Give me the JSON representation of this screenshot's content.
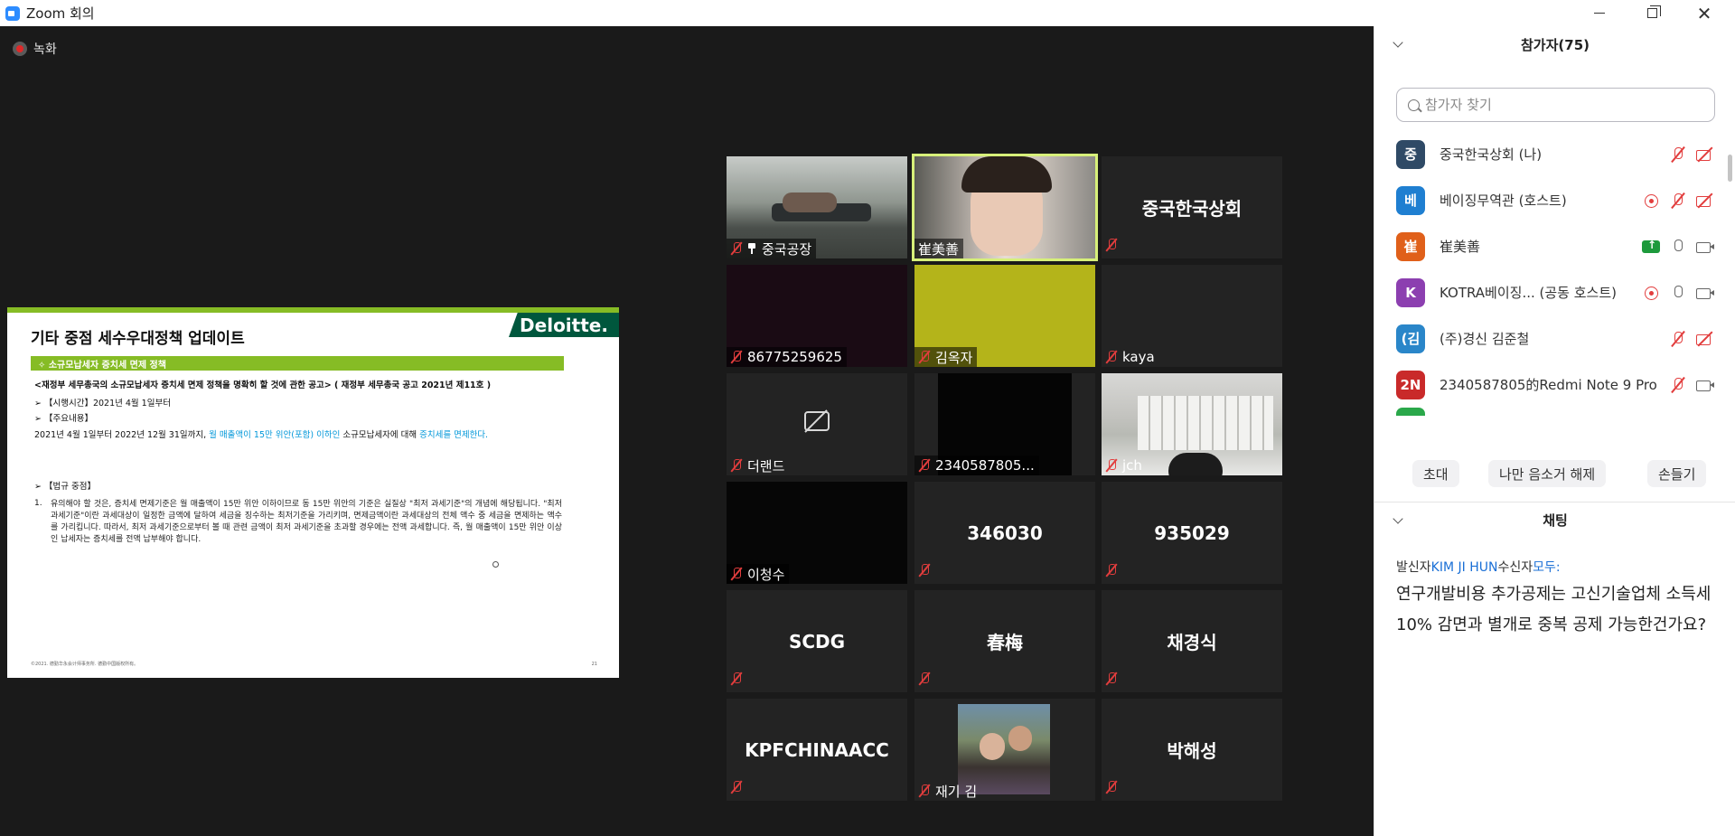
{
  "window": {
    "title": "Zoom 회의"
  },
  "recording": {
    "label": "녹화"
  },
  "slide": {
    "brand": "Deloitte.",
    "title": "기타 중점 세수우대정책 업데이트",
    "band": "✧  소규모납세자 증치세 면제 정책",
    "line1": "<재정부 세무총국의 소규모납세자 증치세 면제 정책을 명확히 할 것에 관한 공고> ( 재정부 세무총국 공고 2021년 제11호 )",
    "line2": "➢  【시행시간】2021년 4월 1일부터",
    "line3": "➢  【주요내용】",
    "line4a": "2021년 4월 1일부터 2022년 12월 31일까지, ",
    "line4b": "월 매출액이 15만 위안(포함) 이하인",
    "line4c": " 소규모납세자에 대해 ",
    "line4d": "증치세를 면제한다.",
    "line5": "➢  【법규 중점】",
    "point_no": "1.",
    "point": "유의해야 할 것은, 증치세 면제기준은 월 매출액이 15만 위안 이하이므로 동 15만 위안의 기준은 실질상 \"최저 과세기준\"의 개념에 해당됩니다. \"최저 과세기준\"이란 과세대상이 일정한 금액에 달하여 세금을 징수하는 최저기준을 가리키며, 면제금액이란 과세대상의 전체 액수 중 세금을 면제하는 액수를 가리킵니다. 따라서, 최저 과세기준으로부터 볼 때 관련 금액이 최저 과세기준을 초과할 경우에는 전액 과세합니다. 즉, 월 매출액이 15만 위안 이상인 납세자는 증치세를 전액 납부해야 합니다.",
    "footer": "©2021. 德勤华永会计师事务所. 德勤中国版权所有。",
    "page": "21"
  },
  "tiles": [
    {
      "name": "중국공장"
    },
    {
      "name": "崔美善"
    },
    {
      "name": "중국한국상회"
    },
    {
      "name": "86775259625"
    },
    {
      "name": "김옥자"
    },
    {
      "name": "kaya"
    },
    {
      "name": "더랜드"
    },
    {
      "name": "2340587805..."
    },
    {
      "name": "jch"
    },
    {
      "name": "이청수"
    },
    {
      "name": "346030"
    },
    {
      "name": "935029"
    },
    {
      "name": "SCDG"
    },
    {
      "name": "春梅"
    },
    {
      "name": "채경식"
    },
    {
      "name": "KPFCHINAACC"
    },
    {
      "name": "재기 김"
    },
    {
      "name": "박해성"
    }
  ],
  "participants_panel": {
    "title": "참가자(75)",
    "search_placeholder": "참가자 찾기",
    "items": [
      {
        "initial": "중",
        "name": "중국한국상회 (나)",
        "color": "#2f4a66",
        "icons": [
          "mic-off",
          "cam-off"
        ]
      },
      {
        "initial": "베",
        "name": "베이징무역관 (호스트)",
        "color": "#1f7fd1",
        "icons": [
          "rec",
          "mic-off",
          "cam-off"
        ]
      },
      {
        "initial": "崔",
        "name": "崔美善",
        "color": "#e0601a",
        "icons": [
          "share",
          "mic",
          "cam"
        ]
      },
      {
        "initial": "K",
        "name": "KOTRA베이징...   (공동 호스트)",
        "color": "#8c3fb0",
        "icons": [
          "rec",
          "mic",
          "cam"
        ]
      },
      {
        "initial": "(김",
        "name": "(주)경신 김준철",
        "color": "#2a86c9",
        "icons": [
          "mic-off",
          "cam-off"
        ]
      },
      {
        "initial": "2N",
        "name": "2340587805的Redmi Note 9 Pro",
        "color": "#c92a2a",
        "icons": [
          "mic-off",
          "cam"
        ]
      }
    ],
    "buttons": {
      "invite": "초대",
      "unmute_me": "나만 음소거 해제",
      "raise_hand": "손들기"
    }
  },
  "chat_panel": {
    "title": "채팅",
    "from_label": "발신자",
    "from": "KIM JI HUN",
    "to_label": "수신자",
    "to": "모두:",
    "message": "연구개발비용 추가공제는 고신기술업체 소득세10% 감면과 별개로 중복 공제 가능한건가요?"
  }
}
